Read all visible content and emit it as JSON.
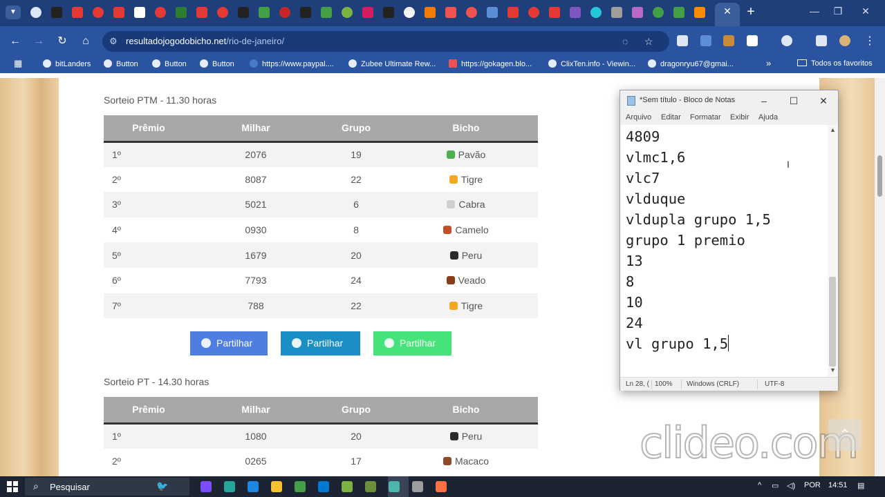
{
  "browser": {
    "url_host": "resultadojogodobicho.net",
    "url_path": "/rio-de-janeiro/",
    "tab_close_icon": "close-icon",
    "tab_icon_colors": [
      "#dfe6f5",
      "#222222",
      "#e53935",
      "#e53935",
      "#e53935",
      "#ffffff",
      "#e53935",
      "#2e7d32",
      "#e53935",
      "#e53935",
      "#222222",
      "#43a047",
      "#c62828",
      "#222222",
      "#43a047",
      "#7cb342",
      "#d81b60",
      "#222222",
      "#f5f5f5",
      "#f57c00",
      "#ef5350",
      "#ef5350",
      "#5c8ed6",
      "#e53935",
      "#e53935",
      "#e53935",
      "#7e57c2",
      "#26c6da",
      "#9e9e9e",
      "#ba68c8",
      "#43a047",
      "#43a047",
      "#fb8c00"
    ]
  },
  "bookmarks": {
    "items": [
      {
        "label": "bitLanders"
      },
      {
        "label": "Button"
      },
      {
        "label": "Button"
      },
      {
        "label": "Button"
      },
      {
        "label": "https://www.paypal...."
      },
      {
        "label": "Zubee Ultimate Rew..."
      },
      {
        "label": "https://gokagen.blo..."
      },
      {
        "label": "ClixTen.info - Viewin..."
      },
      {
        "label": "dragonryu67@gmai..."
      }
    ],
    "more": "»",
    "all_bookmarks": "Todos os favoritos"
  },
  "site": {
    "ptm": {
      "title": "Sorteio PTM - 11.30 horas",
      "headers": [
        "Prêmio",
        "Milhar",
        "Grupo",
        "Bicho"
      ],
      "rows": [
        {
          "premio": "1º",
          "milhar": "2076",
          "grupo": "19",
          "bicho": "Pavão",
          "emoji_color": "#4caf50"
        },
        {
          "premio": "2º",
          "milhar": "8087",
          "grupo": "22",
          "bicho": "Tigre",
          "emoji_color": "#f5a623"
        },
        {
          "premio": "3º",
          "milhar": "5021",
          "grupo": "6",
          "bicho": "Cabra",
          "emoji_color": "#cfcfcf"
        },
        {
          "premio": "4º",
          "milhar": "0930",
          "grupo": "8",
          "bicho": "Camelo",
          "emoji_color": "#c0502a"
        },
        {
          "premio": "5º",
          "milhar": "1679",
          "grupo": "20",
          "bicho": "Peru",
          "emoji_color": "#2b2b2b"
        },
        {
          "premio": "6º",
          "milhar": "7793",
          "grupo": "24",
          "bicho": "Veado",
          "emoji_color": "#8b3a1a"
        },
        {
          "premio": "7º",
          "milhar": "788",
          "grupo": "22",
          "bicho": "Tigre",
          "emoji_color": "#f5a623"
        }
      ]
    },
    "share_buttons": [
      {
        "label": "Partilhar",
        "color": "#4f7ee3",
        "icon": "messenger-icon"
      },
      {
        "label": "Partilhar",
        "color": "#1b8fc4",
        "icon": "telegram-icon"
      },
      {
        "label": "Partilhar",
        "color": "#46e37a",
        "icon": "whatsapp-icon"
      }
    ],
    "pt": {
      "title": "Sorteio PT - 14.30 horas",
      "headers": [
        "Prêmio",
        "Milhar",
        "Grupo",
        "Bicho"
      ],
      "rows": [
        {
          "premio": "1º",
          "milhar": "1080",
          "grupo": "20",
          "bicho": "Peru",
          "emoji_color": "#2b2b2b"
        },
        {
          "premio": "2º",
          "milhar": "0265",
          "grupo": "17",
          "bicho": "Macaco",
          "emoji_color": "#8d4b2a"
        }
      ]
    }
  },
  "notepad": {
    "title": "*Sem título - Bloco de Notas",
    "menu": [
      "Arquivo",
      "Editar",
      "Formatar",
      "Exibir",
      "Ajuda"
    ],
    "lines": [
      "4809",
      "vlmc1,6",
      "vlc7",
      "vlduque",
      "vldupla grupo 1,5",
      "grupo 1 premio",
      "13",
      "8",
      "10",
      "24",
      "vl grupo 1,5"
    ],
    "status": {
      "position": "Ln 28, (",
      "zoom": "100%",
      "eol": "Windows (CRLF)",
      "encoding": "UTF-8"
    }
  },
  "watermark": "clideo.com",
  "taskbar": {
    "search_placeholder": "Pesquisar",
    "language": "POR",
    "time": "14:51",
    "app_colors": [
      "#7c4dff",
      "#26a69a",
      "#1e88e5",
      "#fbc02d",
      "#43a047",
      "#0078d4",
      "#7cb342",
      "#6d8f3a",
      "#4db6ac",
      "#9e9e9e",
      "#ff7043"
    ]
  }
}
